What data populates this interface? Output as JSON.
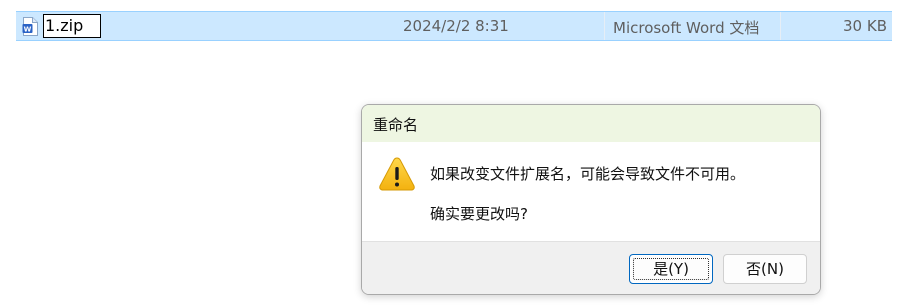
{
  "file_row": {
    "name": "1.zip",
    "date": "2024/2/2 8:31",
    "type": "Microsoft Word 文档",
    "size": "30 KB",
    "icon": "word-document-icon"
  },
  "dialog": {
    "title": "重命名",
    "message": "如果改变文件扩展名，可能会导致文件不可用。",
    "question": "确实要更改吗?",
    "icon": "warning-icon",
    "buttons": {
      "yes": "是(Y)",
      "no": "否(N)"
    }
  },
  "colors": {
    "selection": "#cce8ff",
    "titlebar": "#eef6e2",
    "accent": "#0067c0",
    "warning": "#f8c21c"
  }
}
